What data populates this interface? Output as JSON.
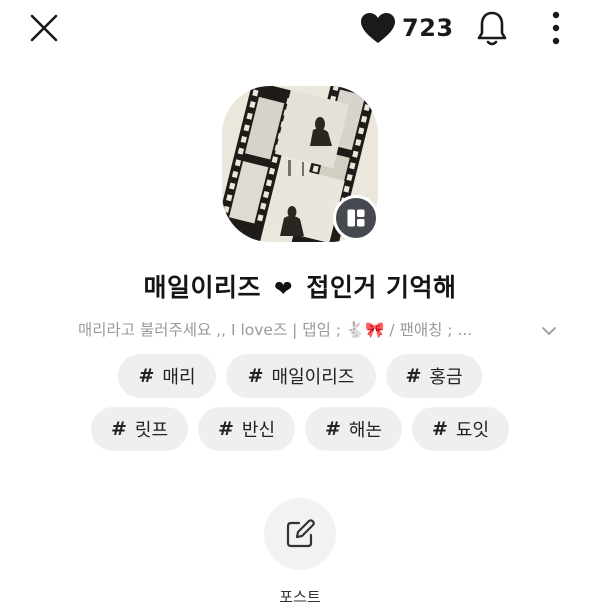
{
  "header": {
    "like_count": "723",
    "icons": [
      "close-icon",
      "heart-icon",
      "bell-icon",
      "more-vertical-icon"
    ]
  },
  "profile": {
    "title_left": "매일이리즈",
    "title_heart": "❤",
    "title_right": "접인거 기억해",
    "bio": "매리라고 불러주세요 ,, I love즈 | 댑임 ; 🐇🎀 / 팬애칭 ; ..."
  },
  "tags": [
    {
      "hash": "#",
      "label": "매리"
    },
    {
      "hash": "#",
      "label": "매일이리즈"
    },
    {
      "hash": "#",
      "label": "홍금"
    },
    {
      "hash": "#",
      "label": "릿프"
    },
    {
      "hash": "#",
      "label": "반신"
    },
    {
      "hash": "#",
      "label": "해논"
    },
    {
      "hash": "#",
      "label": "됴잇"
    }
  ],
  "actions": {
    "post_label": "포스트"
  },
  "colors": {
    "tag_bg": "#efefef",
    "badge_bg": "#46494f",
    "muted_text": "#9a9a9a"
  }
}
